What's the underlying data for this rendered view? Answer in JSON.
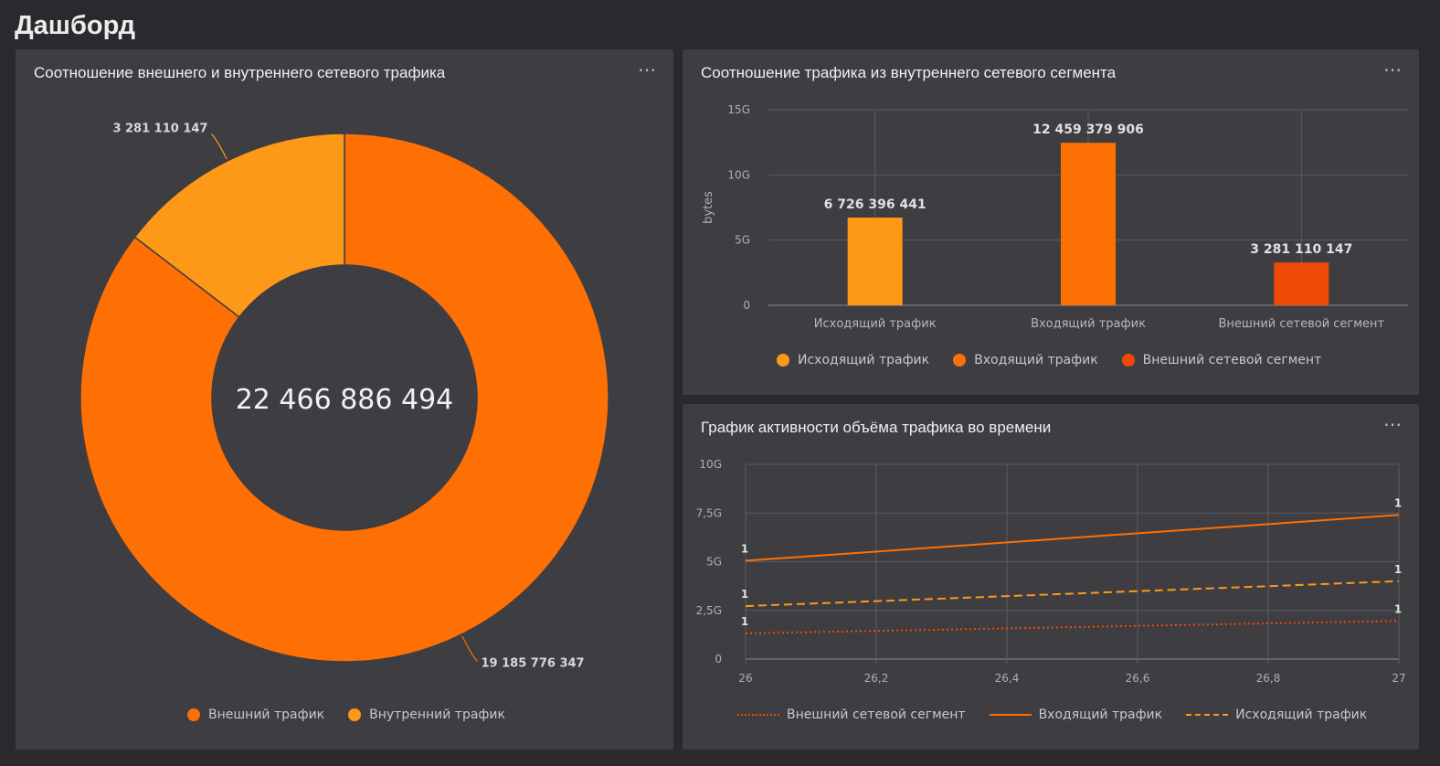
{
  "page": {
    "title": "Дашборд",
    "menu_icon": "ellipsis-icon"
  },
  "colors": {
    "external": "#fe7004",
    "internal": "#fe9918",
    "outgoing": "#fe9918",
    "incoming": "#fe7004",
    "ext_segment": "#ee4a06"
  },
  "chart_data": [
    {
      "type": "pie",
      "title": "Соотношение внешнего и внутреннего сетевого трафика",
      "center_label": "22 466 886 494",
      "slices": [
        {
          "name": "Внешний трафик",
          "value": 19185776347,
          "label": "19 185 776 347",
          "color": "#fe7004"
        },
        {
          "name": "Внутренний трафик",
          "value": 3281110147,
          "label": "3 281 110 147",
          "color": "#fe9918"
        }
      ],
      "legend_position": "bottom"
    },
    {
      "type": "bar",
      "title": "Соотношение трафика из внутреннего сетевого сегмента",
      "ylabel": "bytes",
      "ylim": [
        0,
        15000000000
      ],
      "yticks": [
        {
          "v": 0,
          "label": "0"
        },
        {
          "v": 5000000000,
          "label": "5G"
        },
        {
          "v": 10000000000,
          "label": "10G"
        },
        {
          "v": 15000000000,
          "label": "15G"
        }
      ],
      "categories": [
        "Исходящий трафик",
        "Входящий трафик",
        "Внешний сетевой сегмент"
      ],
      "values": [
        6726396441,
        12459379906,
        3281110147
      ],
      "value_labels": [
        "6 726 396 441",
        "12 459 379 906",
        "3 281 110 147"
      ],
      "colors": [
        "#fe9918",
        "#fe7004",
        "#ee4a06"
      ],
      "legend_position": "bottom"
    },
    {
      "type": "line",
      "title": "График активности объёма трафика во времени",
      "xlim": [
        26,
        27
      ],
      "ylim": [
        0,
        10000000000
      ],
      "xticks": [
        {
          "v": 26,
          "label": "26"
        },
        {
          "v": 26.2,
          "label": "26,2"
        },
        {
          "v": 26.4,
          "label": "26,4"
        },
        {
          "v": 26.6,
          "label": "26,6"
        },
        {
          "v": 26.8,
          "label": "26,8"
        },
        {
          "v": 27,
          "label": "27"
        }
      ],
      "yticks": [
        {
          "v": 0,
          "label": "0"
        },
        {
          "v": 2500000000,
          "label": "2,5G"
        },
        {
          "v": 5000000000,
          "label": "5G"
        },
        {
          "v": 7500000000,
          "label": "7,5G"
        },
        {
          "v": 10000000000,
          "label": "10G"
        }
      ],
      "series": [
        {
          "name": "Внешний сетевой сегмент",
          "dash": "dotted",
          "color": "#ee4a06",
          "x": [
            26,
            27
          ],
          "y": [
            1320000000,
            1960000000
          ],
          "point_labels": [
            "1",
            "1"
          ]
        },
        {
          "name": "Входящий трафик",
          "dash": "solid",
          "color": "#fe7004",
          "x": [
            26,
            27
          ],
          "y": [
            5050000000,
            7400000000
          ],
          "point_labels": [
            "1",
            "1"
          ]
        },
        {
          "name": "Исходящий трафик",
          "dash": "dashed",
          "color": "#fe9918",
          "x": [
            26,
            27
          ],
          "y": [
            2720000000,
            4000000000
          ],
          "point_labels": [
            "1",
            "1"
          ]
        }
      ],
      "legend_position": "bottom"
    }
  ]
}
